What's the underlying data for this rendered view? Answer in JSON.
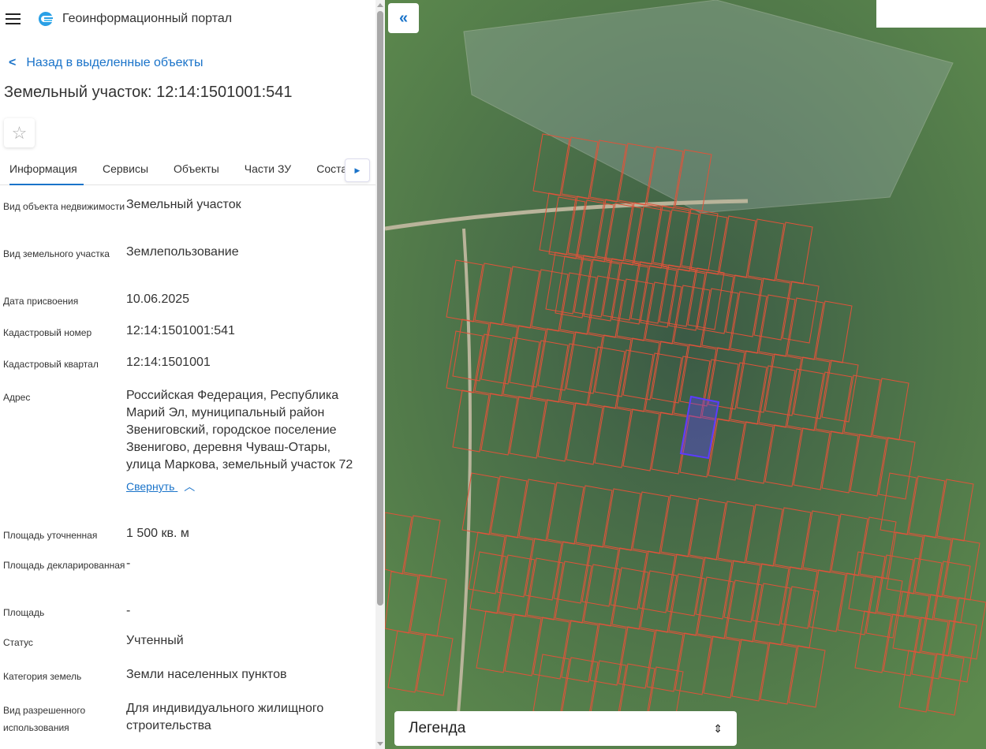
{
  "header": {
    "title": "Геоинформационный портал"
  },
  "back_link": "Назад в выделенные объекты",
  "object_title": "Земельный участок: 12:14:1501001:541",
  "tabs": [
    "Информация",
    "Сервисы",
    "Объекты",
    "Части ЗУ",
    "Соста"
  ],
  "rows": [
    {
      "label": "Вид объекта недвижимости",
      "value": "Земельный участок"
    },
    {
      "label": "Вид земельного участка",
      "value": "Землепользование"
    },
    {
      "label": "Дата присвоения",
      "value": "10.06.2025"
    },
    {
      "label": "Кадастровый номер",
      "value": "12:14:1501001:541"
    },
    {
      "label": "Кадастровый квартал",
      "value": "12:14:1501001"
    },
    {
      "label": "Адрес",
      "value": "Российская Федерация, Республика Марий Эл, муниципальный район Звениговский, городское поселение Звенигово, деревня Чуваш-Отары, улица Маркова, земельный участок 72"
    },
    {
      "label": "Площадь уточненная",
      "value": "1 500 кв. м"
    },
    {
      "label": "Площадь декларированная",
      "value": "-"
    },
    {
      "label": "Площадь",
      "value": "-"
    },
    {
      "label": "Статус",
      "value": "Учтенный"
    },
    {
      "label": "Категория земель",
      "value": "Земли населенных пунктов"
    },
    {
      "label": "Вид разрешенного использования",
      "value": "Для индивидуального жилищного строительства"
    }
  ],
  "collapse_label": "Свернуть",
  "legend": {
    "label": "Легенда"
  },
  "colors": {
    "accent": "#1a73c9",
    "parcel": "#e0533a",
    "selected": "#5b3cff"
  }
}
